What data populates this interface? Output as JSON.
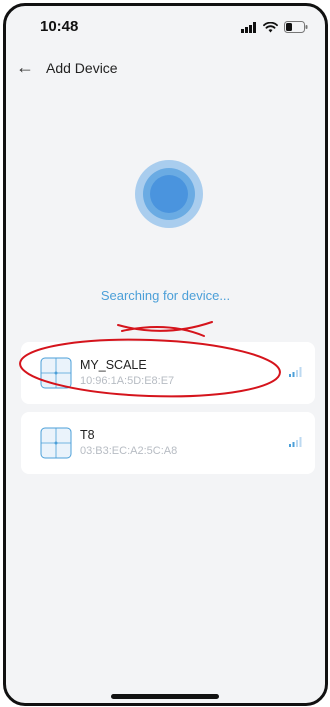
{
  "status": {
    "time": "10:48"
  },
  "header": {
    "title": "Add Device"
  },
  "main": {
    "searching_text": "Searching for device..."
  },
  "devices": [
    {
      "name": "MY_SCALE",
      "mac": "10:96:1A:5D:E8:E7",
      "icon": "scale-icon",
      "signal_icon": "signal-icon"
    },
    {
      "name": "T8",
      "mac": "03:B3:EC:A2:5C:A8",
      "icon": "scale-icon",
      "signal_icon": "signal-icon"
    }
  ],
  "colors": {
    "accent": "#4b9fd8",
    "background": "#f3f4f6",
    "annotation": "#d5141c"
  }
}
